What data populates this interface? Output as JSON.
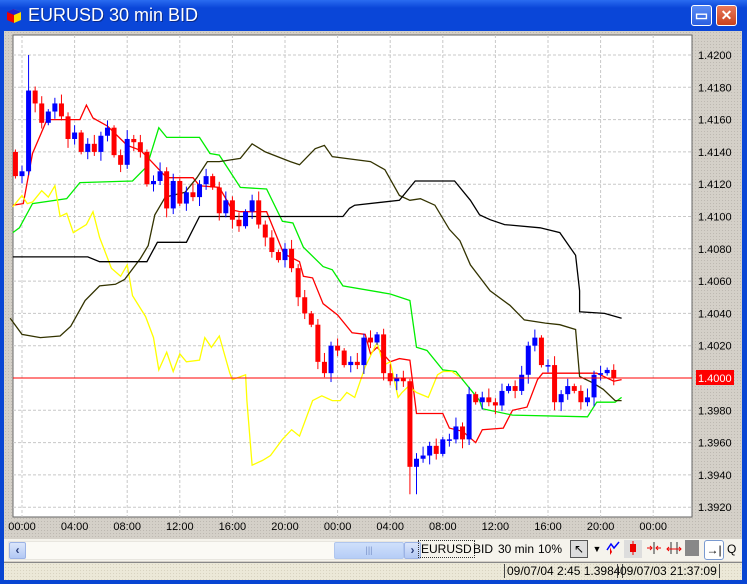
{
  "window": {
    "title": "EURUSD 30 min BID",
    "maximize_icon": "maximize-icon",
    "close_icon": "close-icon"
  },
  "colors": {
    "up": "#0000ff",
    "down": "#ff0000",
    "ma_red": "#ff0000",
    "green": "#00ee00",
    "yellow": "#ffff00",
    "dark": "#333300",
    "black": "#000000",
    "price_line": "#ff0000"
  },
  "chart_data": {
    "type": "candlestick",
    "symbol": "EURUSD",
    "ylim": [
      1.391,
      1.421
    ],
    "y_ticks": [
      "1.4200",
      "1.4180",
      "1.4160",
      "1.4140",
      "1.4120",
      "1.4100",
      "1.4080",
      "1.4060",
      "1.4040",
      "1.4020",
      "1.4000",
      "1.3980",
      "1.3960",
      "1.3940",
      "1.3920"
    ],
    "x_ticks": [
      {
        "hour": 0,
        "label": "00:00"
      },
      {
        "hour": 4,
        "label": "04:00"
      },
      {
        "hour": 8,
        "label": "08:00"
      },
      {
        "hour": 12,
        "label": "12:00"
      },
      {
        "hour": 16,
        "label": "16:00"
      },
      {
        "hour": 20,
        "label": "20:00"
      },
      {
        "hour": 24,
        "label": "00:00"
      },
      {
        "hour": 28,
        "label": "04:00"
      },
      {
        "hour": 32,
        "label": "08:00"
      },
      {
        "hour": 36,
        "label": "12:00"
      },
      {
        "hour": 40,
        "label": "16:00"
      },
      {
        "hour": 44,
        "label": "20:00"
      },
      {
        "hour": 48,
        "label": "00:00"
      }
    ],
    "xlim_hours": [
      -0.7,
      51
    ],
    "current_price": "1.4000",
    "candles": {
      "start_hour": -0.5,
      "interval_hours": 0.5,
      "first_open": 1.414,
      "close": [
        1.4125,
        1.4128,
        1.4178,
        1.417,
        1.4158,
        1.4165,
        1.417,
        1.4162,
        1.4148,
        1.4152,
        1.414,
        1.4145,
        1.414,
        1.415,
        1.4155,
        1.4138,
        1.4132,
        1.4148,
        1.4146,
        1.414,
        1.412,
        1.4122,
        1.4128,
        1.4105,
        1.4122,
        1.4108,
        1.4115,
        1.4112,
        1.412,
        1.4125,
        1.4118,
        1.4102,
        1.411,
        1.4098,
        1.4094,
        1.4103,
        1.411,
        1.4095,
        1.4087,
        1.4078,
        1.4073,
        1.408,
        1.4068,
        1.405,
        1.404,
        1.4033,
        1.401,
        1.4003,
        1.402,
        1.4017,
        1.4008,
        1.401,
        1.4008,
        1.4025,
        1.4022,
        1.4027,
        1.4003,
        1.3998,
        1.4,
        1.3998,
        1.3945,
        1.395,
        1.3952,
        1.3958,
        1.3953,
        1.3962,
        1.3962,
        1.397,
        1.3962,
        1.399,
        1.3985,
        1.3988,
        1.3985,
        1.3983,
        1.3992,
        1.3995,
        1.3992,
        1.4002,
        1.402,
        1.4025,
        1.4008,
        1.4008,
        1.3985,
        1.399,
        1.3995,
        1.3992,
        1.3985,
        1.3988,
        1.4002,
        1.4003,
        1.4005,
        1.4
      ],
      "wick": 0.0005,
      "extremes": [
        {
          "index": 2,
          "high": 1.42
        },
        {
          "index": 60,
          "low": 1.3928
        },
        {
          "index": 61,
          "low": 1.3928
        },
        {
          "index": 82,
          "low": 1.398
        },
        {
          "index": 79,
          "high": 1.403
        }
      ]
    },
    "series": [
      {
        "name": "red-average",
        "color": "ma_red",
        "points": [
          [
            -0.7,
            1.4107
          ],
          [
            0.1,
            1.4108
          ],
          [
            0.8,
            1.4139
          ],
          [
            1.9,
            1.416
          ],
          [
            4.4,
            1.416
          ],
          [
            4.9,
            1.4169
          ],
          [
            5.4,
            1.4161
          ],
          [
            6.5,
            1.4156
          ],
          [
            8.0,
            1.4144
          ],
          [
            9.0,
            1.4141
          ],
          [
            9.5,
            1.4137
          ],
          [
            11,
            1.4124
          ],
          [
            13,
            1.4124
          ],
          [
            13.5,
            1.4119
          ],
          [
            15,
            1.4118
          ],
          [
            16,
            1.4104
          ],
          [
            16.6,
            1.4103
          ],
          [
            18.6,
            1.4103
          ],
          [
            18.9,
            1.4097
          ],
          [
            19.9,
            1.4077
          ],
          [
            21.1,
            1.4072
          ],
          [
            21.4,
            1.4063
          ],
          [
            22.1,
            1.4062
          ],
          [
            22.9,
            1.4046
          ],
          [
            24,
            1.4039
          ],
          [
            25.1,
            1.4028
          ],
          [
            26.1,
            1.4027
          ],
          [
            26.5,
            1.4015
          ],
          [
            27,
            1.4019
          ],
          [
            28,
            1.401
          ],
          [
            28.7,
            1.4012
          ],
          [
            29.5,
            1.4011
          ],
          [
            30,
            1.3978
          ],
          [
            32,
            1.3978
          ],
          [
            32.5,
            1.3969
          ],
          [
            33.5,
            1.3967
          ],
          [
            34.5,
            1.396
          ],
          [
            35,
            1.3968
          ],
          [
            36.6,
            1.3969
          ],
          [
            37.3,
            1.398
          ],
          [
            38.4,
            1.3982
          ],
          [
            39.2,
            1.3999
          ],
          [
            39.6,
            1.4003
          ],
          [
            43.7,
            1.4003
          ],
          [
            45,
            1.3998
          ],
          [
            45.6,
            1.3999
          ]
        ]
      },
      {
        "name": "green-line",
        "color": "green",
        "points": [
          [
            -0.7,
            1.409
          ],
          [
            -0.2,
            1.4093
          ],
          [
            0.8,
            1.4108
          ],
          [
            3.4,
            1.4111
          ],
          [
            4.4,
            1.4121
          ],
          [
            8.4,
            1.4122
          ],
          [
            9.5,
            1.4131
          ],
          [
            10.4,
            1.4155
          ],
          [
            11,
            1.4149
          ],
          [
            13.5,
            1.4149
          ],
          [
            14.3,
            1.4139
          ],
          [
            15,
            1.4138
          ],
          [
            16.6,
            1.4118
          ],
          [
            18.6,
            1.4117
          ],
          [
            19.8,
            1.4097
          ],
          [
            20.6,
            1.4096
          ],
          [
            21.4,
            1.4081
          ],
          [
            22.9,
            1.4069
          ],
          [
            23.6,
            1.4067
          ],
          [
            24.4,
            1.4057
          ],
          [
            28,
            1.4052
          ],
          [
            29.5,
            1.4048
          ],
          [
            30,
            1.4019
          ],
          [
            30.8,
            1.4017
          ],
          [
            32,
            1.4005
          ],
          [
            33,
            1.4004
          ],
          [
            34.8,
            1.3986
          ],
          [
            35,
            1.3981
          ],
          [
            37.3,
            1.3977
          ],
          [
            43,
            1.3976
          ],
          [
            43.7,
            1.3985
          ],
          [
            45.1,
            1.3985
          ],
          [
            45.6,
            1.3988
          ]
        ]
      },
      {
        "name": "yellow-line",
        "color": "yellow",
        "points": [
          [
            -0.7,
            1.4106
          ],
          [
            0,
            1.4113
          ],
          [
            0.4,
            1.4108
          ],
          [
            0.8,
            1.4109
          ],
          [
            1.5,
            1.4116
          ],
          [
            2,
            1.4112
          ],
          [
            2.5,
            1.4119
          ],
          [
            2.9,
            1.41
          ],
          [
            3.4,
            1.4102
          ],
          [
            3.9,
            1.409
          ],
          [
            4.9,
            1.4095
          ],
          [
            5.4,
            1.4103
          ],
          [
            5.9,
            1.4087
          ],
          [
            6.8,
            1.4068
          ],
          [
            7.5,
            1.4063
          ],
          [
            8,
            1.407
          ],
          [
            8.4,
            1.4051
          ],
          [
            9.4,
            1.4038
          ],
          [
            10,
            1.4025
          ],
          [
            10.4,
            1.4005
          ],
          [
            11,
            1.4016
          ],
          [
            11.5,
            1.4004
          ],
          [
            12,
            1.4015
          ],
          [
            12.5,
            1.401
          ],
          [
            13.5,
            1.4011
          ],
          [
            13.9,
            1.4025
          ],
          [
            14.4,
            1.4019
          ],
          [
            15,
            1.4026
          ],
          [
            15.8,
            1.4003
          ],
          [
            16,
            1.3999
          ],
          [
            17,
            1.4002
          ],
          [
            17.1,
            1.3986
          ],
          [
            17.5,
            1.3946
          ],
          [
            18.3,
            1.3949
          ],
          [
            18.9,
            1.3952
          ],
          [
            19.8,
            1.3962
          ],
          [
            20.5,
            1.3968
          ],
          [
            21.1,
            1.3964
          ],
          [
            22.1,
            1.3986
          ],
          [
            22.8,
            1.3989
          ],
          [
            23.6,
            1.3986
          ],
          [
            24.2,
            1.3986
          ],
          [
            24.7,
            1.3991
          ],
          [
            25.3,
            1.3988
          ],
          [
            26.1,
            1.4007
          ],
          [
            27,
            1.4022
          ],
          [
            27.5,
            1.4008
          ],
          [
            28,
            1.401
          ],
          [
            28.6,
            1.3988
          ],
          [
            28.9,
            1.3991
          ],
          [
            29.4,
            1.3995
          ],
          [
            30,
            1.3991
          ],
          [
            30.9,
            1.3988
          ],
          [
            31.6,
            1.4002
          ],
          [
            32,
            1.4004
          ],
          [
            32.7,
            1.4004
          ],
          [
            33.2,
            1.4001
          ]
        ]
      },
      {
        "name": "dark-line",
        "color": "dark",
        "points": [
          [
            -0.9,
            1.4037
          ],
          [
            0,
            1.4027
          ],
          [
            1.4,
            1.4025
          ],
          [
            2.9,
            1.4026
          ],
          [
            3.7,
            1.4032
          ],
          [
            4.8,
            1.4048
          ],
          [
            5.9,
            1.4057
          ],
          [
            7.1,
            1.4058
          ],
          [
            7.8,
            1.4061
          ],
          [
            9,
            1.4074
          ],
          [
            9.6,
            1.4082
          ],
          [
            10.1,
            1.4101
          ],
          [
            10.9,
            1.4112
          ],
          [
            12.4,
            1.4115
          ],
          [
            13.3,
            1.4124
          ],
          [
            14.1,
            1.4134
          ],
          [
            15,
            1.4134
          ],
          [
            16.6,
            1.4136
          ],
          [
            17.5,
            1.4145
          ],
          [
            18.5,
            1.414
          ],
          [
            20.4,
            1.4134
          ],
          [
            21.1,
            1.4132
          ],
          [
            22.3,
            1.4142
          ],
          [
            23,
            1.4144
          ],
          [
            23.6,
            1.4137
          ],
          [
            24.6,
            1.4136
          ],
          [
            26.5,
            1.4134
          ],
          [
            27.6,
            1.4129
          ],
          [
            28.7,
            1.4113
          ],
          [
            29.5,
            1.411
          ],
          [
            30.3,
            1.4111
          ],
          [
            31.4,
            1.4107
          ],
          [
            32.5,
            1.4092
          ],
          [
            33.3,
            1.4085
          ],
          [
            34.1,
            1.407
          ],
          [
            35.6,
            1.4054
          ],
          [
            37.1,
            1.4045
          ],
          [
            38.2,
            1.4036
          ],
          [
            39.8,
            1.4034
          ],
          [
            40.9,
            1.4033
          ],
          [
            42.1,
            1.403
          ],
          [
            42.4,
            1.4001
          ],
          [
            43.4,
            1.3997
          ],
          [
            44.2,
            1.3993
          ],
          [
            45.1,
            1.3986
          ],
          [
            45.6,
            1.3986
          ]
        ]
      },
      {
        "name": "black-line",
        "color": "black",
        "points": [
          [
            -0.7,
            1.4075
          ],
          [
            5,
            1.4075
          ],
          [
            5.9,
            1.4072
          ],
          [
            9.5,
            1.4072
          ],
          [
            10.3,
            1.4084
          ],
          [
            12.5,
            1.4084
          ],
          [
            13.5,
            1.41
          ],
          [
            24.4,
            1.41
          ],
          [
            24.9,
            1.4105
          ],
          [
            25.3,
            1.4107
          ],
          [
            28.7,
            1.411
          ],
          [
            29.9,
            1.4122
          ],
          [
            32.9,
            1.4122
          ],
          [
            34.1,
            1.411
          ],
          [
            34.8,
            1.4101
          ],
          [
            35.6,
            1.4098
          ],
          [
            36.7,
            1.4095
          ],
          [
            39.4,
            1.4093
          ],
          [
            40.9,
            1.409
          ],
          [
            42.1,
            1.4076
          ],
          [
            42.4,
            1.4054
          ],
          [
            42.4,
            1.4041
          ],
          [
            44.3,
            1.404
          ],
          [
            45.6,
            1.4037
          ]
        ]
      }
    ]
  },
  "toolbar": {
    "scroll_left_icon": "‹",
    "scroll_right_icon": "›",
    "thumb_grip": "|||",
    "symbol": "EURUSD",
    "price_type": "BID",
    "period": "30 min",
    "zoom": "10%",
    "cursor_icon": "↖",
    "dropdown_icon": "▼",
    "end_icon": "→|",
    "q_label": "Q"
  },
  "status": {
    "last_bar": "09/07/04 2:45 1.3984",
    "server_time": "09/07/03 21:37:09"
  }
}
